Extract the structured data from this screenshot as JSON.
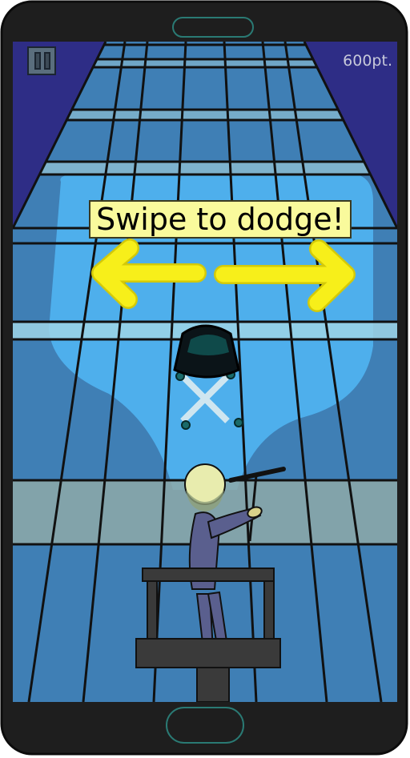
{
  "hud": {
    "pause_icon": "pause-icon",
    "score": "600pt."
  },
  "tutorial": {
    "hint": "Swipe to dodge!",
    "left_arrow_icon": "arrow-left-icon",
    "right_arrow_icon": "arrow-right-icon"
  },
  "colors": {
    "sky": "#2e2d86",
    "floor": "#3f7fb5",
    "spotlight": "#4fb2ef",
    "hint_bg": "#f9fa9c",
    "arrow": "#f7ef1a"
  }
}
